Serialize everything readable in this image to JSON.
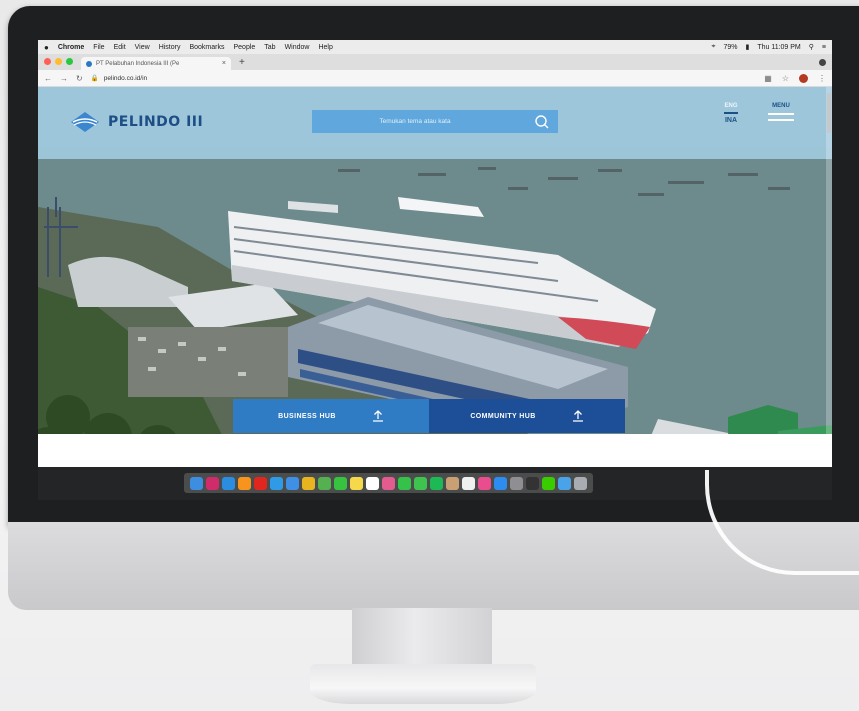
{
  "menubar": {
    "app_name": "Chrome",
    "items": [
      "File",
      "Edit",
      "View",
      "History",
      "Bookmarks",
      "People",
      "Tab",
      "Window",
      "Help"
    ],
    "battery": "79%",
    "clock": "Thu 11:09 PM"
  },
  "browser": {
    "tab_title": "PT Pelabuhan Indonesia III (Pe",
    "url": "pelindo.co.id/in"
  },
  "site": {
    "logo_text": "PELINDO III",
    "search_placeholder": "Temukan tema atau kata",
    "lang_en": "ENG",
    "lang_ina": "INA",
    "menu_label": "MENU",
    "hubs": [
      {
        "label": "BUSINESS HUB"
      },
      {
        "label": "COMMUNITY HUB"
      }
    ]
  },
  "colors": {
    "header_bg": "#a3cde2",
    "brand_blue": "#1d4f86",
    "business_hub": "#2f7bc4",
    "community_hub": "#1c4f97"
  },
  "dock": {
    "icons": [
      "finder-icon",
      "indesign-icon",
      "photoshop-icon",
      "illustrator-icon",
      "acrobat-icon",
      "safari-icon",
      "mail-icon",
      "chrome-icon",
      "maps-icon",
      "facetime-icon",
      "notes-icon",
      "calendar-icon",
      "photos-icon",
      "messages-icon",
      "whatsapp-icon",
      "spotify-icon",
      "contacts-icon",
      "reminders-icon",
      "itunes-icon",
      "appstore-icon",
      "preferences-icon",
      "terminal-icon",
      "line-icon",
      "folder-icon",
      "trash-icon"
    ],
    "icon_colors": [
      "#3d8ee0",
      "#d02b6a",
      "#2a8de0",
      "#f7941e",
      "#e0261e",
      "#2f9be6",
      "#3f8fe4",
      "#e8b41f",
      "#55b04f",
      "#37c240",
      "#f5d94a",
      "#ffffff",
      "#e35b8f",
      "#36c24a",
      "#3ec44e",
      "#1db954",
      "#c9a074",
      "#f0f0f0",
      "#ea4d8d",
      "#2d8cf0",
      "#8e8e93",
      "#333333",
      "#39cd00",
      "#4aa3e8",
      "#a9acb0"
    ]
  }
}
